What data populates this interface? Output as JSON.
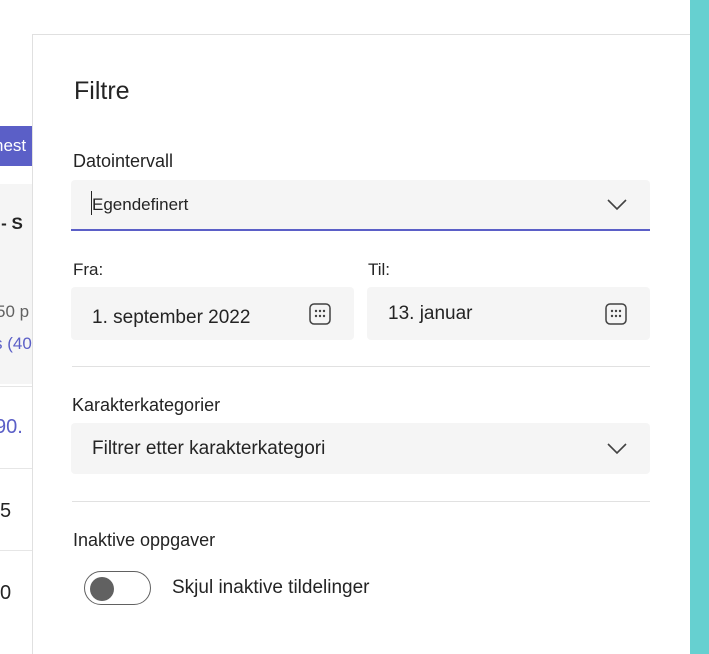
{
  "background": {
    "chip_text": "nest",
    "row_texts": [
      "d - S",
      "50 p",
      "s (40",
      "90.",
      "5",
      "0"
    ]
  },
  "panel": {
    "title": "Filtre",
    "date_range": {
      "label": "Datointervall",
      "value": "Egendefinert"
    },
    "from": {
      "label": "Fra:",
      "value": "1. september 2022"
    },
    "to": {
      "label": "Til:",
      "value": "13. januar"
    },
    "grade_categories": {
      "label": "Karakterkategorier",
      "placeholder": "Filtrer etter karakterkategori"
    },
    "inactive": {
      "label": "Inaktive oppgaver",
      "toggle_label": "Skjul inaktive tildelinger",
      "toggle_on": false
    }
  },
  "colors": {
    "accent": "#5b5fc7",
    "edge": "#66d0d0",
    "field_bg": "#f5f5f5"
  },
  "icons": [
    "chevron-down-icon",
    "calendar-icon"
  ]
}
